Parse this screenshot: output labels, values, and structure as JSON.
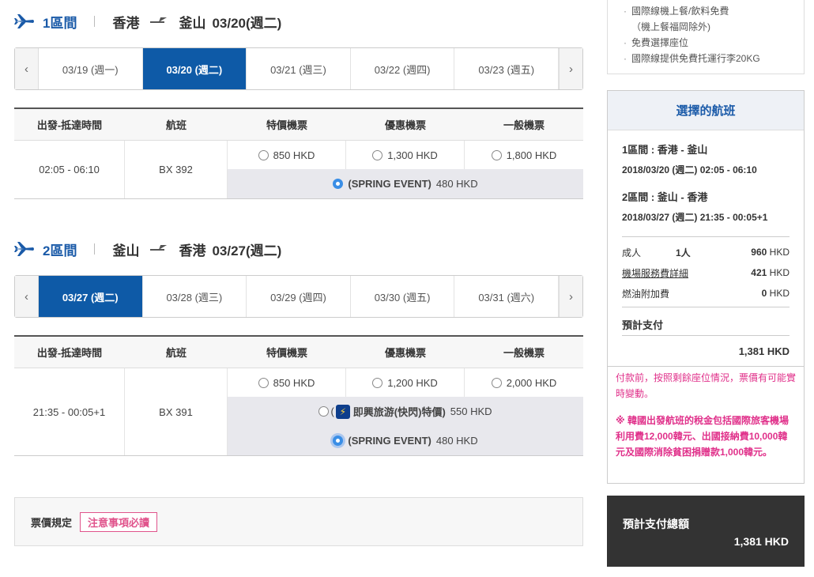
{
  "segment1": {
    "label": "1區間",
    "from": "香港",
    "to": "釜山",
    "date": "03/20(週二)",
    "dates": [
      {
        "label": "03/19 (週一)",
        "active": false
      },
      {
        "label": "03/20 (週二)",
        "active": true
      },
      {
        "label": "03/21 (週三)",
        "active": false
      },
      {
        "label": "03/22 (週四)",
        "active": false
      },
      {
        "label": "03/23 (週五)",
        "active": false
      }
    ],
    "flight": {
      "time": "02:05 - 06:10",
      "number": "BX 392",
      "fare_special": "850 HKD",
      "fare_discount": "1,300 HKD",
      "fare_normal": "1,800 HKD",
      "promo_name": "(SPRING EVENT)",
      "promo_price": "480 HKD"
    }
  },
  "segment2": {
    "label": "2區間",
    "from": "釜山",
    "to": "香港",
    "date": "03/27(週二)",
    "dates": [
      {
        "label": "03/27 (週二)",
        "active": true
      },
      {
        "label": "03/28 (週三)",
        "active": false
      },
      {
        "label": "03/29 (週四)",
        "active": false
      },
      {
        "label": "03/30 (週五)",
        "active": false
      },
      {
        "label": "03/31 (週六)",
        "active": false
      }
    ],
    "flight": {
      "time": "21:35 - 00:05+1",
      "number": "BX 391",
      "fare_special": "850 HKD",
      "fare_discount": "1,200 HKD",
      "fare_normal": "2,000 HKD",
      "flash_open": "(",
      "flash_name": "即興旅游(快閃)特價)",
      "flash_price": "550 HKD",
      "promo_name": "(SPRING EVENT)",
      "promo_price": "480 HKD"
    }
  },
  "table_headers": {
    "time": "出發-抵達時間",
    "flight": "航班",
    "special": "特價機票",
    "discount": "優惠機票",
    "normal": "一般機票"
  },
  "rules": {
    "label": "票價規定",
    "button": "注意事項必讀"
  },
  "benefits": [
    "國際線機上餐/飲料免費",
    "（機上餐福岡除外)",
    "免費選擇座位",
    "國際線提供免費托運行李20KG"
  ],
  "selected": {
    "title": "選擇的航班",
    "seg1_route": "1區間 : 香港 - 釜山",
    "seg1_datetime": "2018/03/20 (週二) 02:05 - 06:10",
    "seg2_route": "2區間 : 釜山 - 香港",
    "seg2_datetime": "2018/03/27 (週二) 21:35 - 00:05+1",
    "adult_label": "成人",
    "adult_qty": "1人",
    "adult_num": "960",
    "adult_unit": " HKD",
    "airport_label": "機場服務費詳細",
    "airport_num": "421",
    "airport_unit": " HKD",
    "fuel_label": "燃油附加費",
    "fuel_num": "0",
    "fuel_unit": " HKD",
    "estimate_label": "預計支付",
    "estimate_value": "1,381 HKD"
  },
  "notice": {
    "line1": "付款前，按照剩餘座位情況，票價有可能實時變動。",
    "line2": "※ 韓國出發航班的稅金包括國際旅客機場利用費12,000韓元、出國接納費10,000韓元及國際消除貧困捐贈款1,000韓元。"
  },
  "total": {
    "label": "預計支付總額",
    "value": "1,381 HKD"
  },
  "nav": {
    "prev": "‹",
    "next": "›"
  },
  "colors": {
    "brand": "#0e5aa7",
    "accent_pink": "#e0308a",
    "dark_panel": "#333333"
  }
}
